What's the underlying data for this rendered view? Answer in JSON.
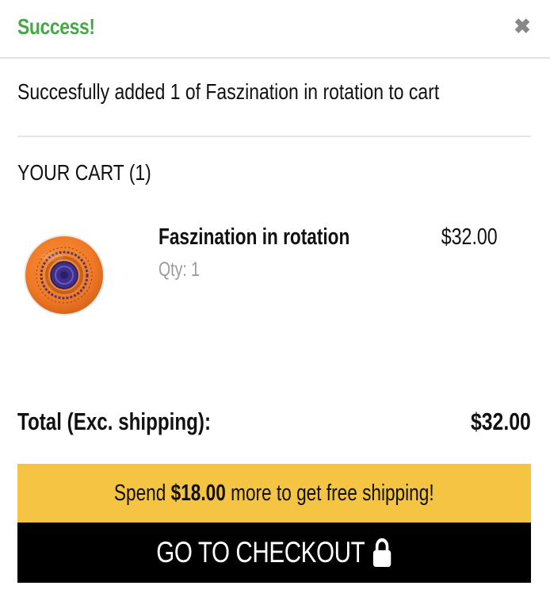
{
  "header": {
    "title": "Success!",
    "close_icon": "close-icon"
  },
  "message": "Succesfully added 1 of Faszination in rotation to cart",
  "cart": {
    "title": "YOUR CART (1)",
    "items": [
      {
        "name": "Faszination in rotation",
        "qty": "Qty: 1",
        "price": "$32.00"
      }
    ]
  },
  "total": {
    "label": "Total (Exc. shipping):",
    "value": "$32.00"
  },
  "shipping": {
    "prefix": "Spend ",
    "amount": "$18.00",
    "suffix": " more to get free shipping!"
  },
  "checkout": {
    "label": "GO TO CHECKOUT",
    "icon": "lock-icon"
  },
  "colors": {
    "success": "#4aa64a",
    "banner": "#f4c442",
    "button": "#000000",
    "muted": "#9a9a9a",
    "disc": "#f07a26"
  }
}
